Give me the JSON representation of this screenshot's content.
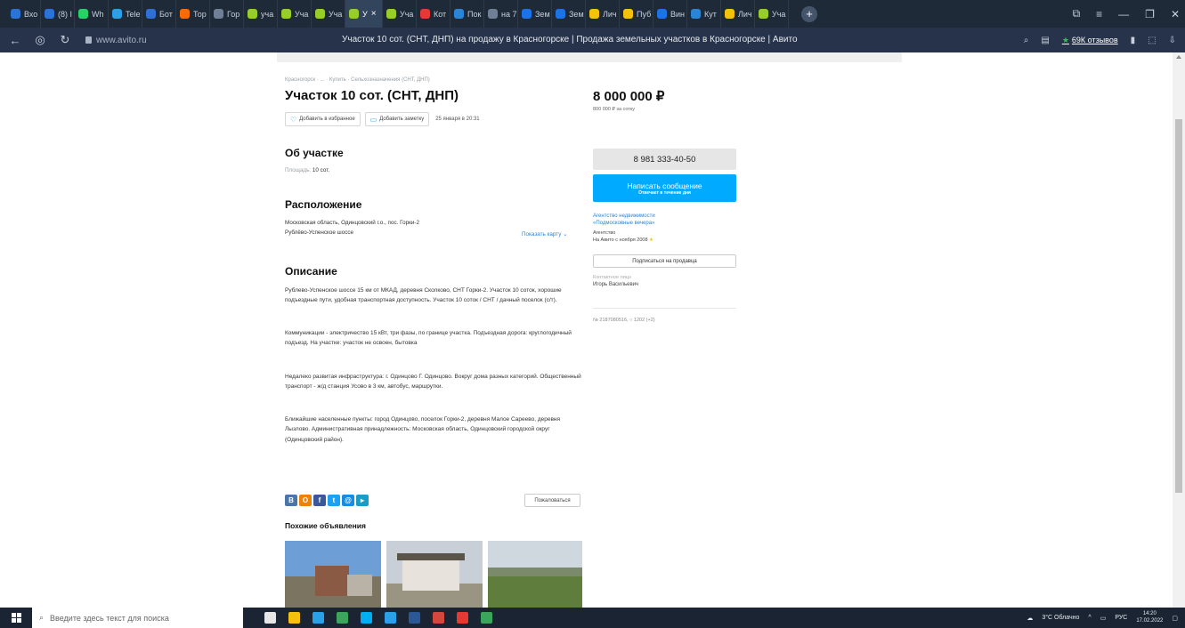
{
  "browser": {
    "tabs": [
      {
        "label": "Вхо",
        "color": "#2a73d9"
      },
      {
        "label": "(8) I",
        "color": "#2a73d9"
      },
      {
        "label": "Wh",
        "color": "#25d366"
      },
      {
        "label": "Tele",
        "color": "#2aa1e6"
      },
      {
        "label": "Бот",
        "color": "#2f6fd6"
      },
      {
        "label": "Тор",
        "color": "#ff6a00"
      },
      {
        "label": "Гор",
        "color": "#6f7f96"
      },
      {
        "label": "уча",
        "color": "#97cf26"
      },
      {
        "label": "Уча",
        "color": "#97cf26"
      },
      {
        "label": "Уча",
        "color": "#97cf26"
      },
      {
        "label": "У",
        "color": "#97cf26",
        "active": true,
        "close": "×"
      },
      {
        "label": "Уча",
        "color": "#97cf26"
      },
      {
        "label": "Кот",
        "color": "#e53935"
      },
      {
        "label": "Пок",
        "color": "#2a85d6"
      },
      {
        "label": "на 7",
        "color": "#6f7f96"
      },
      {
        "label": "Зем",
        "color": "#1a73e8"
      },
      {
        "label": "Зем",
        "color": "#1a73e8"
      },
      {
        "label": "Лич",
        "color": "#f4c20d"
      },
      {
        "label": "Пуб",
        "color": "#f4c20d"
      },
      {
        "label": "Вин",
        "color": "#1a73e8"
      },
      {
        "label": "Кут",
        "color": "#2a85d6"
      },
      {
        "label": "Лич",
        "color": "#f4c20d"
      },
      {
        "label": "Уча",
        "color": "#97cf26"
      }
    ],
    "new_tab": "+",
    "url": "www.avito.ru",
    "title": "Участок 10 сот. (СНТ, ДНП) на продажу в Красногорске | Продажа земельных участков в Красногорске | Авито",
    "reviews": "69К отзывов"
  },
  "listing": {
    "breadcrumb": "Красногорск · ... · Купить · Сельхозназначения (СНТ, ДНП)",
    "title": "Участок 10 сот. (СНТ, ДНП)",
    "add_fav": "Добавить в избранное",
    "add_note": "Добавить заметку",
    "date": "25 января в 20:31",
    "about_h": "Об участке",
    "area_label": "Площадь:",
    "area_value": "10 сот.",
    "location_h": "Расположение",
    "address": "Московская область, Одинцовский г.о., пос. Горки-2",
    "highway": "Рублёво-Успенское шоссе",
    "show_map": "Показать карту ⌄",
    "desc_h": "Описание",
    "desc_p1": "Рублево-Успенское шоссе 15 км от МКАД, деревня Сколково, СНТ Горки-2. Участок 10 соток, хорошие подъездные пути, удобная транспортная доступность. Участок 10 соток / СНТ / дачный поселок (с/т).",
    "desc_p2": "Коммуникации - электричество 15 кВт, три фазы, по границе участка. Подъездная дорога: круглогодичный подъезд. На участке: участок не освоен, бытовка",
    "desc_p3": "Недалеко развитая инфраструктура: г. Одинцово Г. Одинцово. Вокруг дома разных категорий. Общественный транспорт - ж/д станция Усово в 3 км, автобус, маршрутки.",
    "desc_p4": "Ближайшие населенные пункты: город Одинцово, поселок Горки-2, деревня Малое Сареево, деревня Лызлово. Административная принадлежность: Московская область, Одинцовский городской округ (Одинцовский район).",
    "share": [
      {
        "label": "В",
        "color": "#4a76a8"
      },
      {
        "label": "О",
        "color": "#ee8208"
      },
      {
        "label": "f",
        "color": "#3b5998"
      },
      {
        "label": "t",
        "color": "#1da1f2"
      },
      {
        "label": "@",
        "color": "#168de2"
      },
      {
        "label": "▸",
        "color": "#1a9cc5"
      }
    ],
    "complain": "Пожаловаться",
    "similar_h": "Похожие объявления"
  },
  "seller": {
    "price": "8 000 000 ₽",
    "price_per": "800 000 ₽ за сотку",
    "phone": "8 981 333-40-50",
    "msg_main": "Написать сообщение",
    "msg_sub": "Отвечает в течение дня",
    "agency_l1": "Агентство недвижимости",
    "agency_l2": "«Подмосковные вечера»",
    "type": "Агентство",
    "since": "На Авито с ноября 2008",
    "subscribe": "Подписаться на продавца",
    "contact_label": "Контактное лицо",
    "contact_name": "Игорь Васильевич",
    "listing_no": "№ 2187080516, ○ 1202 (+2)"
  },
  "taskbar": {
    "search_placeholder": "Введите здесь текст для поиска",
    "weather": "3°C Облачно",
    "lang": "РУС",
    "time": "14:20",
    "date": "17.02.2022",
    "apps": [
      "#e6e6e6",
      "#f4c20d",
      "#2aa1e6",
      "#3ba55c",
      "#00aff0",
      "#2aa1e6",
      "#2b5797",
      "#d4473c",
      "#e53935",
      "#3ba55c"
    ]
  }
}
